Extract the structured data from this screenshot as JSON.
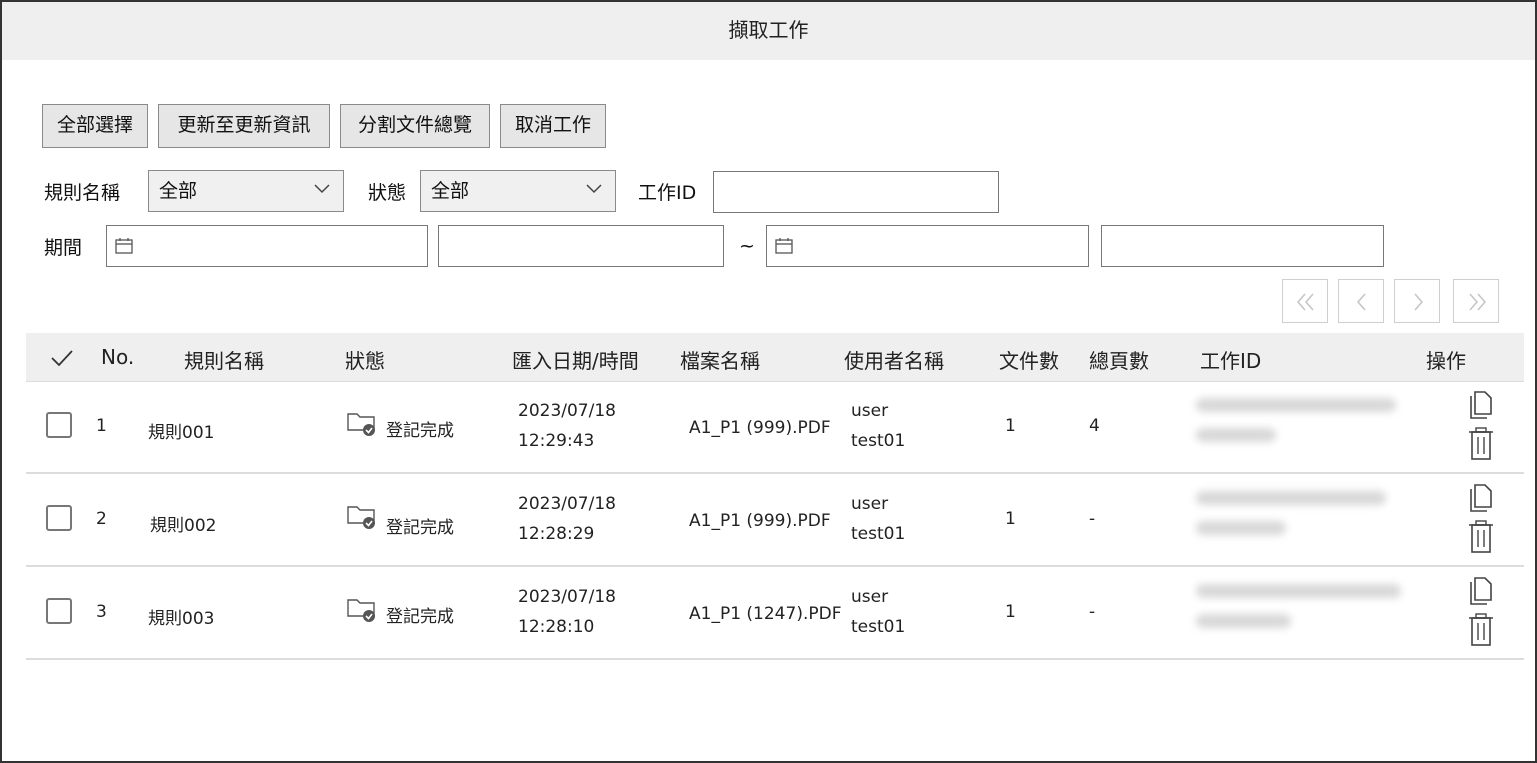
{
  "window": {
    "title": "擷取工作"
  },
  "toolbar": {
    "select_all": "全部選擇",
    "update_info": "更新至更新資訊",
    "split_overview": "分割文件總覽",
    "cancel_job": "取消工作"
  },
  "filters": {
    "rule_label": "規則名稱",
    "rule_value": "全部",
    "status_label": "狀態",
    "status_value": "全部",
    "jobid_label": "工作ID",
    "jobid_value": "",
    "period_label": "期間",
    "start_date": "",
    "start_time": "",
    "range_sep": "~",
    "end_date": "",
    "end_time": ""
  },
  "pager": {
    "icons": [
      "first-page-icon",
      "prev-page-icon",
      "next-page-icon",
      "last-page-icon"
    ]
  },
  "table": {
    "columns": {
      "check": "✓",
      "no": "No.",
      "rule": "規則名稱",
      "status": "狀態",
      "import_datetime": "匯入日期/時間",
      "file": "檔案名稱",
      "user": "使用者名稱",
      "docs": "文件數",
      "pages": "總頁數",
      "jobid": "工作ID",
      "ops": "操作"
    },
    "rows": [
      {
        "no": "1",
        "rule": "規則001",
        "status": "登記完成",
        "date": "2023/07/18",
        "time": "12:29:43",
        "file": "A1_P1 (999).PDF",
        "user1": "user",
        "user2": "test01",
        "docs": "1",
        "pages": "4"
      },
      {
        "no": "2",
        "rule": "規則002",
        "status": "登記完成",
        "date": "2023/07/18",
        "time": "12:28:29",
        "file": "A1_P1 (999).PDF",
        "user1": "user",
        "user2": "test01",
        "docs": "1",
        "pages": "-"
      },
      {
        "no": "3",
        "rule": "規則003",
        "status": "登記完成",
        "date": "2023/07/18",
        "time": "12:28:10",
        "file": "A1_P1 (1247).PDF",
        "user1": "user",
        "user2": "test01",
        "docs": "1",
        "pages": "-"
      }
    ]
  }
}
